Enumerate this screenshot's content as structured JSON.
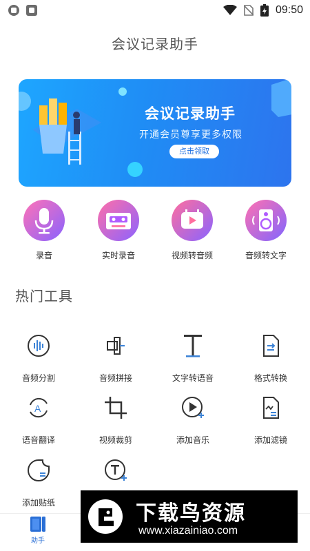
{
  "status_bar": {
    "time": "09:50",
    "icons": [
      "shield-icon",
      "a-letter-icon",
      "wifi-icon",
      "no-sim-icon",
      "battery-charging-icon"
    ]
  },
  "header": {
    "title": "会议记录助手"
  },
  "banner": {
    "title": "会议记录助手",
    "subtitle": "开通会员尊享更多权限",
    "button_label": "点击领取"
  },
  "features": [
    {
      "label": "录音",
      "icon": "microphone-icon"
    },
    {
      "label": "实时录音",
      "icon": "cassette-icon"
    },
    {
      "label": "视频转音频",
      "icon": "video-play-icon"
    },
    {
      "label": "音频转文字",
      "icon": "speaker-icon"
    }
  ],
  "hot_tools": {
    "title": "热门工具",
    "items": [
      {
        "label": "音频分割",
        "icon": "waveform-icon"
      },
      {
        "label": "音频拼接",
        "icon": "join-icon"
      },
      {
        "label": "文字转语音",
        "icon": "text-t-icon"
      },
      {
        "label": "格式转换",
        "icon": "file-convert-icon"
      },
      {
        "label": "语音翻译",
        "icon": "translate-icon"
      },
      {
        "label": "视频裁剪",
        "icon": "crop-icon"
      },
      {
        "label": "添加音乐",
        "icon": "play-add-icon"
      },
      {
        "label": "添加滤镜",
        "icon": "file-filter-icon"
      },
      {
        "label": "添加贴纸",
        "icon": "sticker-icon"
      },
      {
        "label": "",
        "icon": "text-add-icon"
      }
    ]
  },
  "bottom_nav": {
    "items": [
      {
        "label": "助手",
        "icon": "book-icon",
        "active": true
      }
    ]
  },
  "watermark": {
    "title": "下载鸟资源",
    "url": "www.xiazainiao.com"
  },
  "colors": {
    "accent": "#2a6fd6",
    "banner": "#1f8df5",
    "feature_gradient_start": "#ff6fb5",
    "feature_gradient_end": "#7b6cff"
  }
}
